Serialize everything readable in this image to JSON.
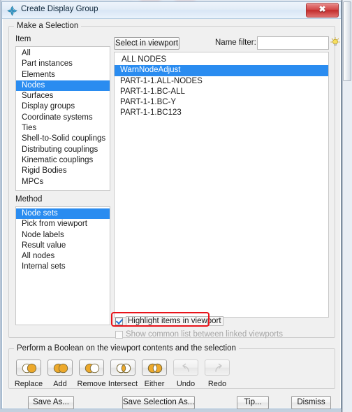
{
  "window": {
    "title": "Create Display Group",
    "icon": "abaqus-diamond-icon",
    "close_label": "✖"
  },
  "selection_group": {
    "title": "Make a Selection"
  },
  "item": {
    "label": "Item",
    "options": [
      "All",
      "Part instances",
      "Elements",
      "Nodes",
      "Surfaces",
      "Display groups",
      "Coordinate systems",
      "Ties",
      "Shell-to-Solid couplings",
      "Distributing couplings",
      "Kinematic couplings",
      "Rigid Bodies",
      "MPCs"
    ],
    "selected": "Nodes"
  },
  "method": {
    "label": "Method",
    "options": [
      "Node sets",
      "Pick from viewport",
      "Node labels",
      "Result value",
      "All nodes",
      "Internal sets"
    ],
    "selected": "Node sets"
  },
  "toolbar": {
    "select_in_viewport_label": "Select in viewport",
    "name_filter_label": "Name filter:",
    "name_filter_value": "",
    "name_filter_placeholder": "",
    "tip_bulb_icon": "lightbulb-icon"
  },
  "node_sets": {
    "items": [
      "ALL NODES",
      "WarnNodeAdjust",
      "PART-1-1.ALL-NODES",
      "PART-1-1.BC-ALL",
      "PART-1-1.BC-Y",
      "PART-1-1.BC123"
    ],
    "selected": "WarnNodeAdjust"
  },
  "checkboxes": {
    "highlight": {
      "label": "Highlight items in viewport",
      "checked": true,
      "enabled": true,
      "annotated": true
    },
    "common_list": {
      "label": "Show common list between linked viewports",
      "checked": false,
      "enabled": false,
      "annotated": false
    }
  },
  "boolean_group": {
    "title": "Perform a Boolean on the viewport contents and the selection",
    "buttons": [
      {
        "label": "Replace",
        "icon": "venn-replace-icon",
        "enabled": true
      },
      {
        "label": "Add",
        "icon": "venn-add-icon",
        "enabled": true
      },
      {
        "label": "Remove",
        "icon": "venn-remove-icon",
        "enabled": true
      },
      {
        "label": "Intersect",
        "icon": "venn-intersect-icon",
        "enabled": true
      },
      {
        "label": "Either",
        "icon": "venn-either-icon",
        "enabled": true
      },
      {
        "label": "Undo",
        "icon": "undo-arrow-icon",
        "enabled": false
      },
      {
        "label": "Redo",
        "icon": "redo-arrow-icon",
        "enabled": false
      }
    ]
  },
  "footer": {
    "save_as_label": "Save As...",
    "save_selection_as_label": "Save Selection As...",
    "tip_label": "Tip...",
    "dismiss_label": "Dismiss"
  },
  "colors": {
    "selection_blue": "#2a8cf0",
    "annotation_red": "#e8131a",
    "venn_gold": "#eda92b",
    "close_red": "#c22c2c"
  }
}
